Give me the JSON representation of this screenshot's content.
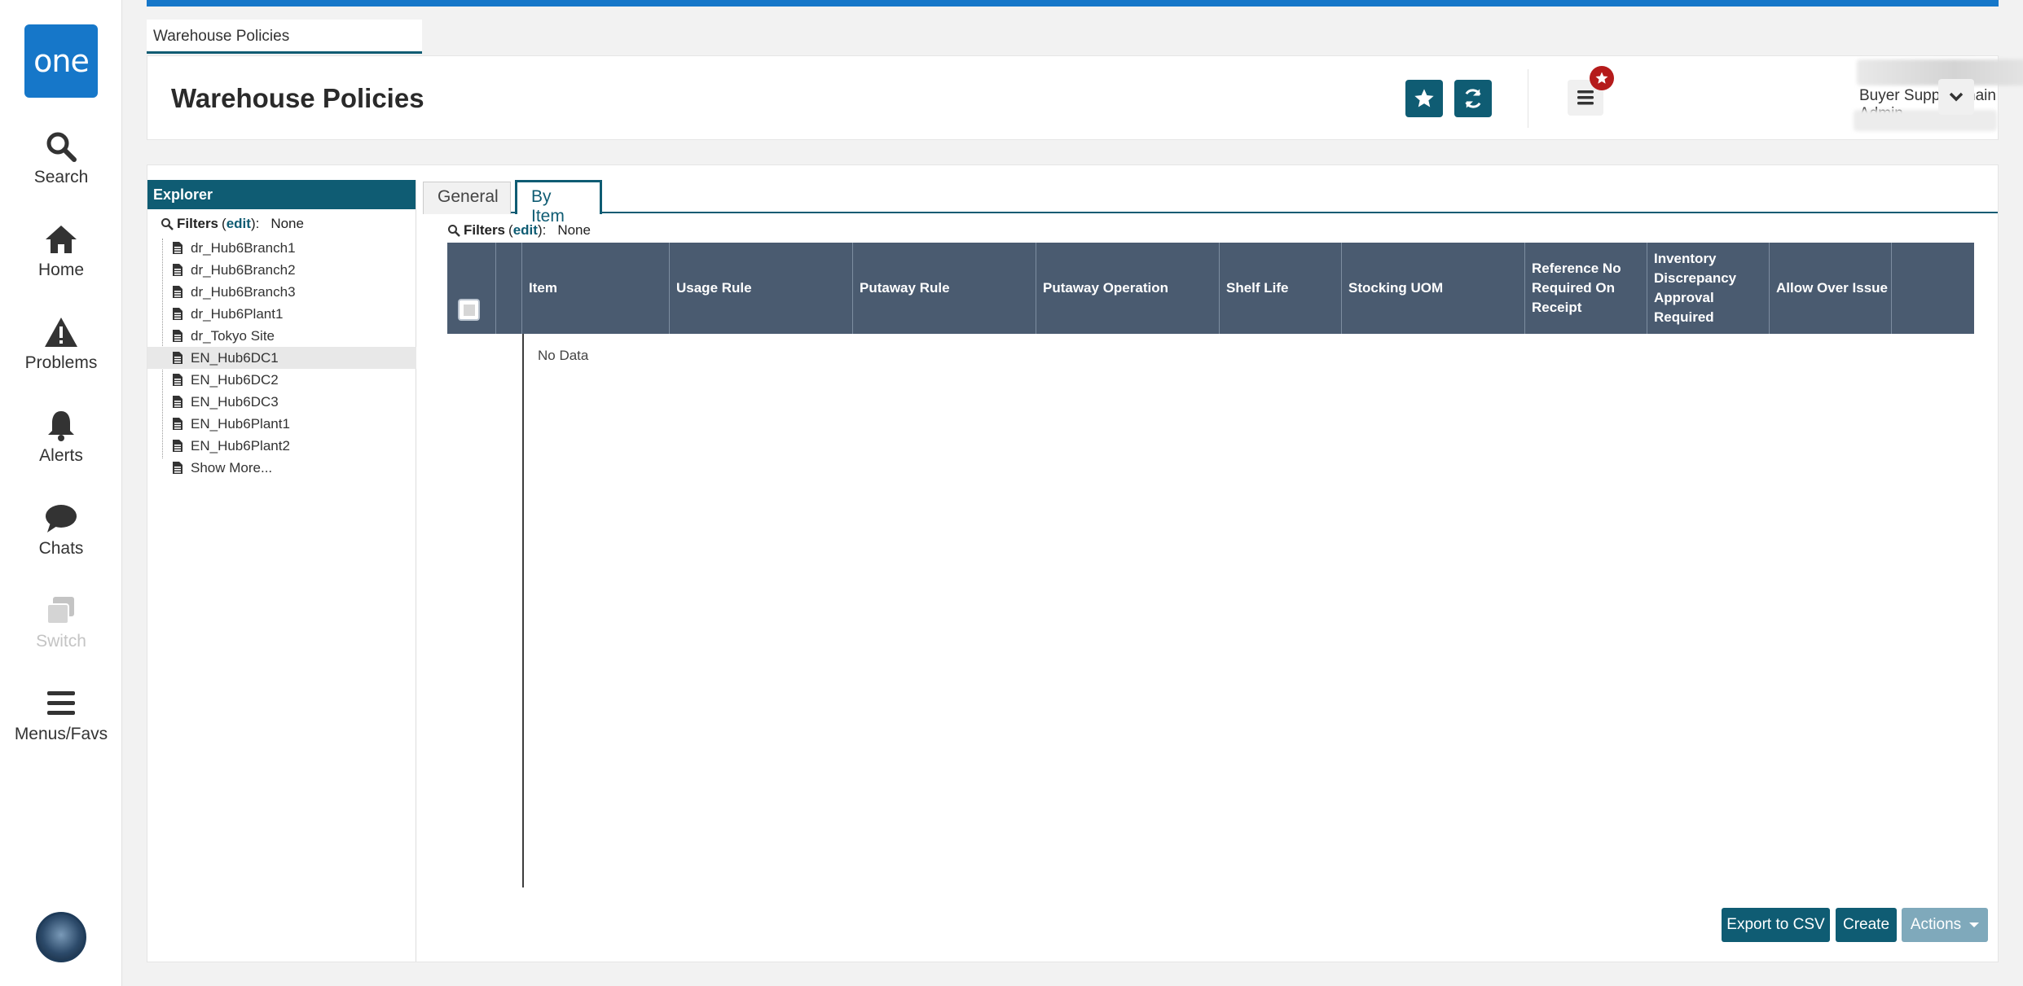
{
  "rail": {
    "logo": "one",
    "items": [
      {
        "label": "Search",
        "icon": "search-icon"
      },
      {
        "label": "Home",
        "icon": "home-icon"
      },
      {
        "label": "Problems",
        "icon": "warning-icon"
      },
      {
        "label": "Alerts",
        "icon": "bell-icon"
      },
      {
        "label": "Chats",
        "icon": "chat-icon"
      },
      {
        "label": "Switch",
        "icon": "switch-icon"
      },
      {
        "label": "Menus/Favs",
        "icon": "menu-icon"
      }
    ]
  },
  "page_tab": "Warehouse Policies",
  "header": {
    "title": "Warehouse Policies",
    "role": "Buyer Supply Chain Admin"
  },
  "explorer": {
    "title": "Explorer",
    "filters_label": "Filters",
    "filters_edit": "edit",
    "filters_value": "None",
    "items": [
      "dr_Hub6Branch1",
      "dr_Hub6Branch2",
      "dr_Hub6Branch3",
      "dr_Hub6Plant1",
      "dr_Tokyo Site",
      "EN_Hub6DC1",
      "EN_Hub6DC2",
      "EN_Hub6DC3",
      "EN_Hub6Plant1",
      "EN_Hub6Plant2",
      "Show More..."
    ],
    "selected": "EN_Hub6DC1"
  },
  "tabs": [
    "General",
    "By Item"
  ],
  "active_tab": "By Item",
  "content_filters": {
    "label": "Filters",
    "edit": "edit",
    "value": "None"
  },
  "grid": {
    "columns": [
      "Item",
      "Usage Rule",
      "Putaway Rule",
      "Putaway Operation",
      "Shelf Life",
      "Stocking UOM",
      "Reference No Required On Receipt",
      "Inventory Discrepancy Approval Required",
      "Allow Over Issue"
    ],
    "empty_text": "No Data"
  },
  "buttons": {
    "export": "Export to CSV",
    "create": "Create",
    "actions": "Actions"
  },
  "colors": {
    "primary": "#0f5c73",
    "accent_blue": "#1677c9",
    "grid_header": "#4a5b70",
    "badge_red": "#b51b1b"
  }
}
